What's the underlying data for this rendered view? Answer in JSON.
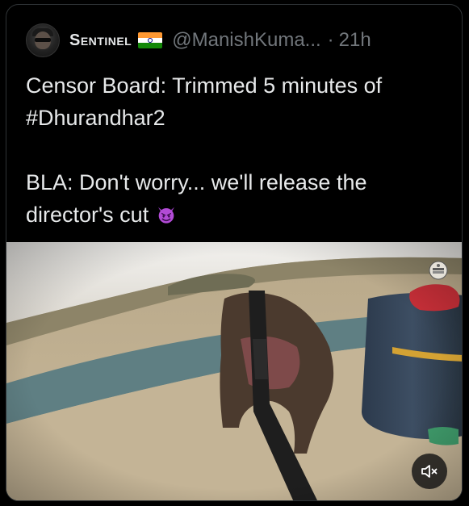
{
  "post": {
    "author": {
      "display_name": "Sentinel",
      "handle": "@ManishKuma...",
      "separator": "·",
      "timestamp": "21h",
      "flag": "india-flag"
    },
    "text_line_1": "Censor Board: Trimmed 5 minutes of",
    "text_line_2": "#Dhurandhar2",
    "text_line_3": "BLA: Don't worry... we'll release the",
    "text_line_4": "director's cut",
    "emoji": "smiling-imp-emoji"
  },
  "media": {
    "type": "video",
    "controls": {
      "mute_icon": "speaker-muted-icon"
    }
  },
  "colors": {
    "background": "#000000",
    "text_primary": "#e7e9ea",
    "text_secondary": "#71767b",
    "border": "#2f3336",
    "emoji_purple": "#b24bd6"
  }
}
